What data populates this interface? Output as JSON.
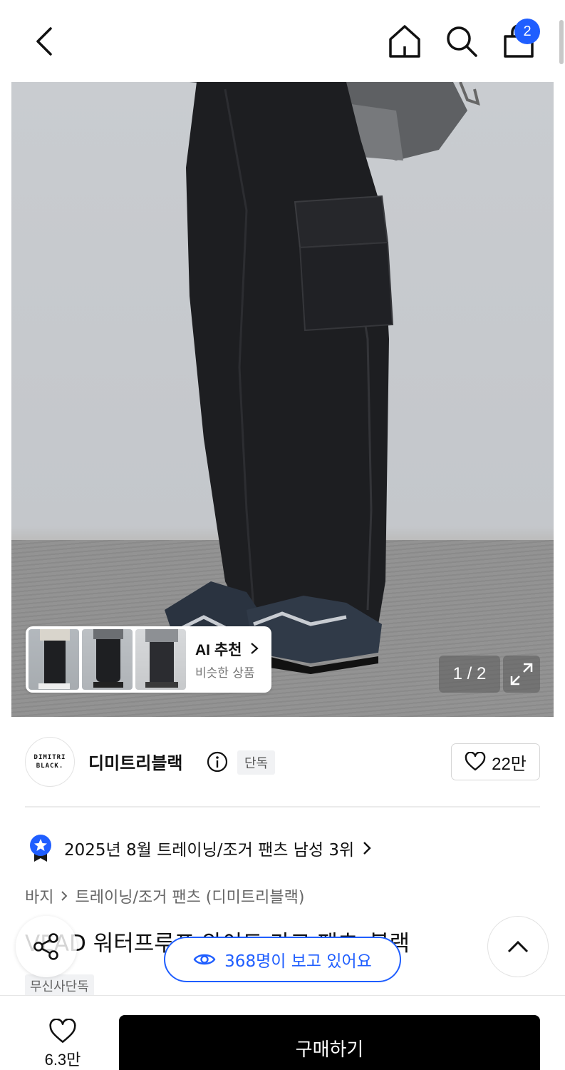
{
  "header": {
    "back_icon": "chevron-left-icon",
    "home_icon": "home-icon",
    "search_icon": "search-icon",
    "cart_icon": "shopping-bag-icon",
    "cart_badge": "2",
    "badge_color": "#1f5eff"
  },
  "gallery": {
    "image_description": "product-photo-black-cargo-pants",
    "ai_recommend": {
      "title": "AI 추천",
      "subtitle": "비슷한 상품"
    },
    "pager": "1 / 2",
    "expand_icon": "expand-icon"
  },
  "brand": {
    "logo_line1": "DIMITRI",
    "logo_line2": "BLACK.",
    "name": "디미트리블랙",
    "exclusive_tag": "단독",
    "like_count": "22만"
  },
  "ranking": {
    "text": "2025년 8월 트레이닝/조거 팬츠 남성 3위",
    "icon": "star-medal-icon",
    "accent": "#1f5eff"
  },
  "breadcrumb": {
    "category": "바지",
    "subcategory": "트레이닝/조거 팬츠 (디미트리블랙)"
  },
  "product": {
    "title": "VEAD 워터프루프 와이드 카고 팬츠_블랙",
    "musinsa_tag": "무신사단독",
    "viewers": "368명이 보고 있어요"
  },
  "bottom": {
    "fav_count": "6.3만",
    "buy_label": "구매하기"
  }
}
